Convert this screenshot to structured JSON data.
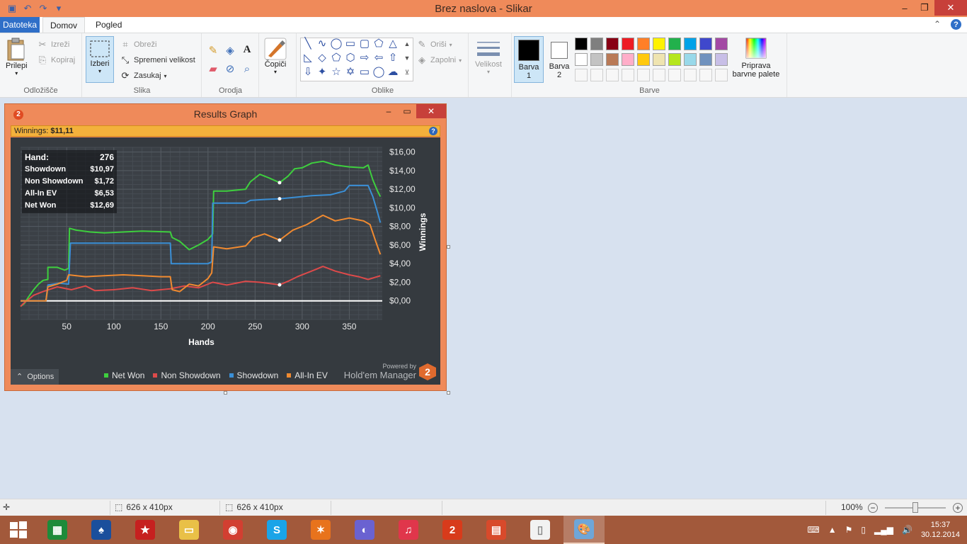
{
  "window": {
    "title": "Brez naslova - Slikar",
    "minimize": "–",
    "maximize": "❐",
    "close": "✕"
  },
  "quick_access": [
    "save-icon",
    "undo-icon",
    "redo-icon",
    "customize-icon"
  ],
  "tabs": {
    "file": "Datoteka",
    "home": "Domov",
    "view": "Pogled",
    "help": "?",
    "collapse": "⌃"
  },
  "ribbon": {
    "clipboard": {
      "paste": "Prilepi",
      "cut": "Izreži",
      "copy": "Kopiraj",
      "label": "Odložišče"
    },
    "image": {
      "select": "Izberi",
      "crop": "Obreži",
      "resize": "Spremeni velikost",
      "rotate": "Zasukaj",
      "label": "Slika"
    },
    "tools": {
      "label": "Orodja"
    },
    "brushes": {
      "label": "Čopiči"
    },
    "shapes": {
      "outline": "Oriši",
      "fill": "Zapolni",
      "label": "Oblike"
    },
    "size": {
      "label": "Velikost"
    },
    "colors": {
      "color1": "Barva 1",
      "color2": "Barva 2",
      "edit_colors": "Priprava barvne palete",
      "label": "Barve",
      "palette_row1": [
        "#000000",
        "#7f7f7f",
        "#880015",
        "#ed1c24",
        "#ff7f27",
        "#fff200",
        "#22b14c",
        "#00a2e8",
        "#3f48cc",
        "#a349a4"
      ],
      "palette_row2": [
        "#ffffff",
        "#c3c3c3",
        "#b97a57",
        "#ffaec9",
        "#ffc90e",
        "#efe4b0",
        "#b5e61d",
        "#99d9ea",
        "#7092be",
        "#c8bfe7"
      ]
    }
  },
  "results_graph": {
    "title": "Results Graph",
    "winnings_label": "Winnings:",
    "winnings_value": "$11,11",
    "stats": [
      {
        "label": "Hand:",
        "value": "276"
      },
      {
        "label": "Showdown",
        "value": "$10,97"
      },
      {
        "label": "Non Showdown",
        "value": "$1,72"
      },
      {
        "label": "All-In EV",
        "value": "$6,53"
      },
      {
        "label": "Net Won",
        "value": "$12,69"
      }
    ],
    "options": "Options",
    "powered_by": "Powered by",
    "brand": "Hold'em Manager",
    "logo_text": "2"
  },
  "chart_data": {
    "type": "line",
    "xlabel": "Hands",
    "ylabel": "Winnings",
    "xlim": [
      1,
      385
    ],
    "ylim": [
      -2,
      16.5
    ],
    "x_ticks": [
      50,
      100,
      150,
      200,
      250,
      300,
      350
    ],
    "y_ticks": [
      {
        "v": 0,
        "label": "$0,00"
      },
      {
        "v": 2,
        "label": "$2,00"
      },
      {
        "v": 4,
        "label": "$4,00"
      },
      {
        "v": 6,
        "label": "$6,00"
      },
      {
        "v": 8,
        "label": "$8,00"
      },
      {
        "v": 10,
        "label": "$10,00"
      },
      {
        "v": 12,
        "label": "$12,00"
      },
      {
        "v": 14,
        "label": "$14,00"
      },
      {
        "v": 16,
        "label": "$16,00"
      }
    ],
    "grid": true,
    "legend_position": "bottom",
    "marker_x": 276,
    "series": [
      {
        "name": "Net Won",
        "color": "#3ecf3e",
        "points": [
          [
            1,
            -0.6
          ],
          [
            5,
            -0.3
          ],
          [
            10,
            0.5
          ],
          [
            15,
            1.2
          ],
          [
            20,
            1.8
          ],
          [
            25,
            2.2
          ],
          [
            30,
            2.3
          ],
          [
            30,
            3.6
          ],
          [
            40,
            3.6
          ],
          [
            48,
            3.3
          ],
          [
            52,
            3.5
          ],
          [
            53,
            7.8
          ],
          [
            60,
            7.6
          ],
          [
            75,
            7.4
          ],
          [
            90,
            7.3
          ],
          [
            110,
            7.4
          ],
          [
            130,
            7.5
          ],
          [
            160,
            7.4
          ],
          [
            162,
            6.8
          ],
          [
            170,
            6.4
          ],
          [
            180,
            5.5
          ],
          [
            190,
            6.0
          ],
          [
            200,
            6.6
          ],
          [
            205,
            7.2
          ],
          [
            206,
            11.8
          ],
          [
            220,
            11.8
          ],
          [
            240,
            12.0
          ],
          [
            245,
            12.8
          ],
          [
            255,
            13.6
          ],
          [
            265,
            13.2
          ],
          [
            276,
            12.7
          ],
          [
            285,
            13.4
          ],
          [
            292,
            14.2
          ],
          [
            300,
            14.3
          ],
          [
            310,
            14.8
          ],
          [
            322,
            15.0
          ],
          [
            335,
            14.6
          ],
          [
            350,
            14.4
          ],
          [
            365,
            14.3
          ],
          [
            370,
            14.6
          ],
          [
            375,
            13.0
          ],
          [
            380,
            11.8
          ],
          [
            383,
            11.2
          ]
        ]
      },
      {
        "name": "Non Showdown",
        "color": "#dd4a4a",
        "points": [
          [
            1,
            -0.6
          ],
          [
            5,
            -0.2
          ],
          [
            15,
            0.6
          ],
          [
            25,
            1.0
          ],
          [
            40,
            1.5
          ],
          [
            55,
            1.2
          ],
          [
            70,
            1.6
          ],
          [
            80,
            1.1
          ],
          [
            100,
            1.2
          ],
          [
            120,
            1.4
          ],
          [
            140,
            1.1
          ],
          [
            160,
            1.3
          ],
          [
            175,
            1.6
          ],
          [
            190,
            1.4
          ],
          [
            205,
            2.0
          ],
          [
            220,
            1.7
          ],
          [
            240,
            2.1
          ],
          [
            255,
            2.0
          ],
          [
            276,
            1.72
          ],
          [
            285,
            2.1
          ],
          [
            295,
            2.6
          ],
          [
            305,
            3.0
          ],
          [
            315,
            3.4
          ],
          [
            322,
            3.7
          ],
          [
            335,
            3.2
          ],
          [
            350,
            2.8
          ],
          [
            360,
            2.6
          ],
          [
            370,
            2.3
          ],
          [
            383,
            2.7
          ]
        ]
      },
      {
        "name": "Showdown",
        "color": "#3a8fd6",
        "points": [
          [
            1,
            0.0
          ],
          [
            28,
            0.0
          ],
          [
            30,
            1.7
          ],
          [
            42,
            1.9
          ],
          [
            52,
            1.8
          ],
          [
            54,
            6.2
          ],
          [
            110,
            6.2
          ],
          [
            160,
            6.2
          ],
          [
            161,
            4.0
          ],
          [
            200,
            4.0
          ],
          [
            204,
            4.2
          ],
          [
            205,
            10.5
          ],
          [
            240,
            10.5
          ],
          [
            245,
            10.8
          ],
          [
            260,
            10.9
          ],
          [
            276,
            10.97
          ],
          [
            290,
            11.1
          ],
          [
            310,
            11.3
          ],
          [
            330,
            11.4
          ],
          [
            345,
            11.8
          ],
          [
            350,
            12.4
          ],
          [
            370,
            12.4
          ],
          [
            375,
            11.2
          ],
          [
            380,
            9.5
          ],
          [
            383,
            8.4
          ]
        ]
      },
      {
        "name": "All-In EV",
        "color": "#f08a30",
        "points": [
          [
            1,
            0.0
          ],
          [
            28,
            0.0
          ],
          [
            30,
            1.5
          ],
          [
            40,
            1.8
          ],
          [
            50,
            2.2
          ],
          [
            52,
            2.8
          ],
          [
            70,
            2.6
          ],
          [
            90,
            2.7
          ],
          [
            110,
            2.8
          ],
          [
            130,
            2.7
          ],
          [
            150,
            2.6
          ],
          [
            160,
            2.6
          ],
          [
            162,
            1.2
          ],
          [
            170,
            1.0
          ],
          [
            180,
            1.8
          ],
          [
            190,
            1.6
          ],
          [
            200,
            2.4
          ],
          [
            204,
            3.0
          ],
          [
            206,
            5.8
          ],
          [
            220,
            5.6
          ],
          [
            240,
            5.9
          ],
          [
            248,
            6.8
          ],
          [
            260,
            7.2
          ],
          [
            276,
            6.53
          ],
          [
            290,
            7.6
          ],
          [
            305,
            8.2
          ],
          [
            315,
            8.8
          ],
          [
            322,
            9.2
          ],
          [
            335,
            8.6
          ],
          [
            350,
            8.9
          ],
          [
            365,
            8.6
          ],
          [
            372,
            8.2
          ],
          [
            378,
            6.4
          ],
          [
            383,
            5.0
          ]
        ]
      }
    ]
  },
  "statusbar": {
    "selection_size": "626 x 410px",
    "image_size": "626 x 410px",
    "zoom": "100%",
    "zoom_out": "−",
    "zoom_in": "+"
  },
  "taskbar": {
    "clock_time": "15:37",
    "clock_date": "30.12.2014",
    "apps": [
      {
        "name": "excel-icon",
        "color": "#1e8b3a",
        "glyph": "▦"
      },
      {
        "name": "pokerstars-spade-icon",
        "color": "#1b4f9c",
        "glyph": "♠"
      },
      {
        "name": "pokerstars-icon",
        "color": "#c6201f",
        "glyph": "★"
      },
      {
        "name": "file-explorer-icon",
        "color": "#e9c047",
        "glyph": "▭"
      },
      {
        "name": "chrome-icon",
        "color": "#d23f31",
        "glyph": "◉"
      },
      {
        "name": "skype-icon",
        "color": "#1aa4e8",
        "glyph": "S"
      },
      {
        "name": "avast-icon",
        "color": "#e8731c",
        "glyph": "✶"
      },
      {
        "name": "browser-globe-icon",
        "color": "#6a62d1",
        "glyph": "◐"
      },
      {
        "name": "itunes-icon",
        "color": "#e0364b",
        "glyph": "♫"
      },
      {
        "name": "holdem-manager-icon",
        "color": "#d83b1b",
        "glyph": "2"
      },
      {
        "name": "mp3-file-icon",
        "color": "#d84a2b",
        "glyph": "▤"
      },
      {
        "name": "blank-file-icon",
        "color": "#f2f2f2",
        "glyph": "▯"
      },
      {
        "name": "paint-icon",
        "color": "#6ea6d8",
        "glyph": "🎨"
      }
    ]
  }
}
